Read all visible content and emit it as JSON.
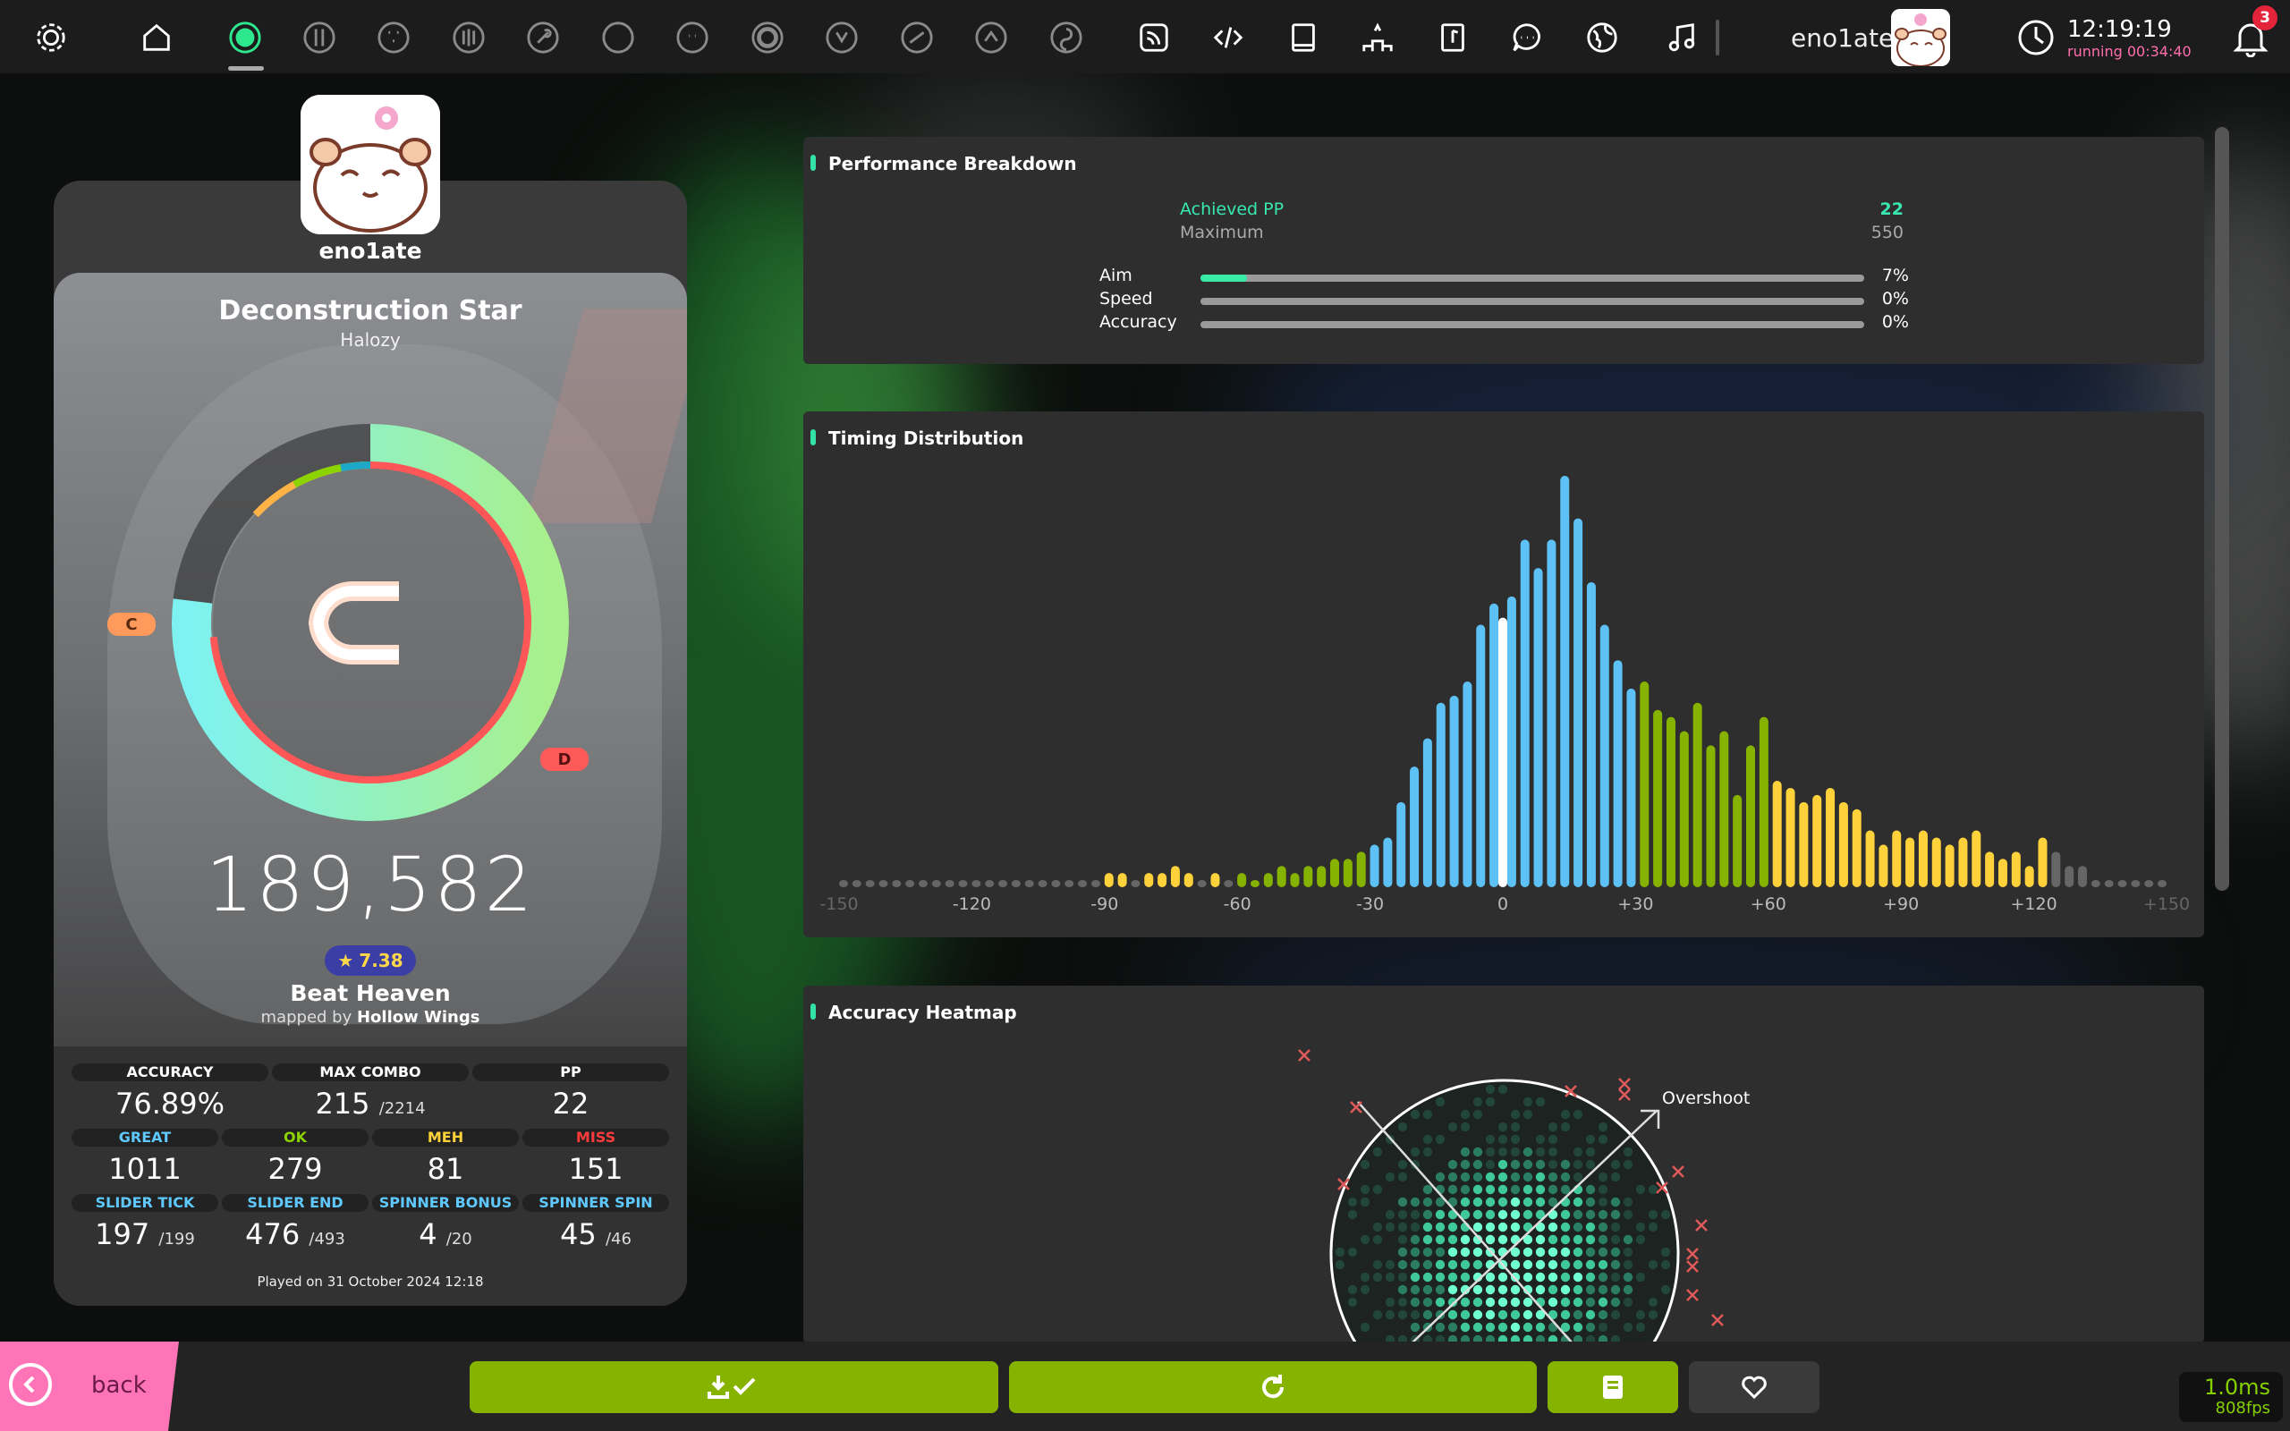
{
  "toolbar": {
    "icons": [
      "settings-icon",
      "home-icon",
      "osu-mode-icon",
      "taiko-mode-icon",
      "catch-mode-icon",
      "mania-mode-icon",
      "mod-autopilot-icon",
      "mod-relax-icon",
      "mod-spunout-icon",
      "mod-touch-icon",
      "mod-hidden-icon",
      "mod-flashlight-icon",
      "mod-doubletime-icon",
      "mod-nofail-icon",
      "rss-icon",
      "code-icon",
      "book-icon",
      "ranking-icon",
      "beatmap-listing-icon",
      "chat-icon",
      "globe-icon",
      "music-icon"
    ],
    "username": "eno1ate",
    "time": "12:19:19",
    "running": "running 00:34:40",
    "notification_count": "3"
  },
  "player": {
    "name": "eno1ate"
  },
  "beatmap": {
    "title": "Deconstruction Star",
    "artist": "Halozy",
    "difficulty": "Beat Heaven",
    "mapped_by_prefix": "mapped by",
    "mapper": "Hollow Wings",
    "star_rating": "7.38"
  },
  "score": {
    "total": "189,582",
    "grade": "C",
    "grade_left_tag": "C",
    "grade_right_tag": "D",
    "accuracy_fraction": 0.7689,
    "played_on": "Played on 31 October 2024 12:18"
  },
  "stats": {
    "accuracy": {
      "label": "ACCURACY",
      "value": "76.89%"
    },
    "max_combo": {
      "label": "MAX COMBO",
      "value": "215",
      "max": "/2214"
    },
    "pp": {
      "label": "PP",
      "value": "22"
    },
    "great": {
      "label": "GREAT",
      "value": "1011",
      "color": "#5ec8ff"
    },
    "ok": {
      "label": "OK",
      "value": "279",
      "color": "#8cd400"
    },
    "meh": {
      "label": "MEH",
      "value": "81",
      "color": "#ffd23b"
    },
    "miss": {
      "label": "MISS",
      "value": "151",
      "color": "#ff3b3b"
    },
    "slider_tick": {
      "label": "SLIDER TICK",
      "value": "197",
      "max": "/199"
    },
    "slider_end": {
      "label": "SLIDER END",
      "value": "476",
      "max": "/493"
    },
    "spinner_bonus": {
      "label": "SPINNER BONUS",
      "value": "4",
      "max": "/20"
    },
    "spinner_spin": {
      "label": "SPINNER SPIN",
      "value": "45",
      "max": "/46"
    }
  },
  "performance": {
    "title": "Performance Breakdown",
    "achieved_label": "Achieved PP",
    "achieved_value": "22",
    "maximum_label": "Maximum",
    "maximum_value": "550",
    "rows": [
      {
        "label": "Aim",
        "value": "7%",
        "fraction": 0.07
      },
      {
        "label": "Speed",
        "value": "0%",
        "fraction": 0
      },
      {
        "label": "Accuracy",
        "value": "0%",
        "fraction": 0
      }
    ]
  },
  "timing": {
    "title": "Timing Distribution",
    "tick_labels": [
      "-150",
      "-120",
      "-90",
      "-60",
      "-30",
      "0",
      "+30",
      "+60",
      "+90",
      "+120",
      "+150"
    ],
    "tick_values": [
      -150,
      -120,
      -90,
      -60,
      -30,
      0,
      30,
      60,
      90,
      120,
      150
    ],
    "colors": {
      "great": "#5ec1f5",
      "ok": "#86b300",
      "meh": "#ffd23b",
      "miss": "#666666",
      "zero": "#ffffff"
    },
    "window_great": 30,
    "window_ok": 60
  },
  "chart_data": {
    "type": "bar",
    "title": "Timing Distribution",
    "xlabel": "",
    "ylabel": "",
    "xlim": [
      -150,
      150
    ],
    "x": [
      -149,
      -146,
      -143,
      -140,
      -137,
      -134,
      -131,
      -128,
      -125,
      -122,
      -119,
      -116,
      -113,
      -110,
      -107,
      -104,
      -101,
      -98,
      -95,
      -92,
      -89,
      -86,
      -83,
      -80,
      -77,
      -74,
      -71,
      -68,
      -65,
      -62,
      -59,
      -56,
      -53,
      -50,
      -47,
      -44,
      -41,
      -38,
      -35,
      -32,
      -29,
      -26,
      -23,
      -20,
      -17,
      -14,
      -11,
      -8,
      -5,
      -2,
      0,
      2,
      5,
      8,
      11,
      14,
      17,
      20,
      23,
      26,
      29,
      32,
      35,
      38,
      41,
      44,
      47,
      50,
      53,
      56,
      59,
      62,
      65,
      68,
      71,
      74,
      77,
      80,
      83,
      86,
      89,
      92,
      95,
      98,
      101,
      104,
      107,
      110,
      113,
      116,
      119,
      122,
      125,
      128,
      131,
      134,
      137,
      140,
      143,
      146,
      149
    ],
    "values": [
      1,
      1,
      1,
      1,
      1,
      1,
      1,
      1,
      1,
      1,
      1,
      1,
      1,
      1,
      1,
      1,
      1,
      1,
      1,
      1,
      2,
      2,
      1,
      2,
      2,
      3,
      2,
      1,
      2,
      1,
      2,
      1,
      2,
      3,
      2,
      3,
      3,
      4,
      4,
      5,
      6,
      7,
      12,
      17,
      21,
      26,
      27,
      29,
      37,
      40,
      38,
      41,
      49,
      45,
      49,
      58,
      52,
      43,
      37,
      32,
      28,
      29,
      25,
      24,
      22,
      26,
      20,
      22,
      13,
      20,
      24,
      15,
      14,
      12,
      13,
      14,
      12,
      11,
      8,
      6,
      8,
      7,
      8,
      7,
      6,
      7,
      8,
      5,
      4,
      5,
      3,
      7,
      5,
      3,
      3,
      1,
      1,
      1,
      1,
      1,
      1
    ],
    "categories_by_window": [
      "miss",
      "meh",
      "ok",
      "great"
    ]
  },
  "heatmap": {
    "title": "Accuracy Heatmap",
    "overshoot_label": "Overshoot"
  },
  "bottom": {
    "back_label": "back",
    "buttons": [
      "download-check-icon",
      "replay-icon",
      "save-icon",
      "heart-icon"
    ],
    "frame_time": "1.0ms",
    "fps": "808fps"
  }
}
